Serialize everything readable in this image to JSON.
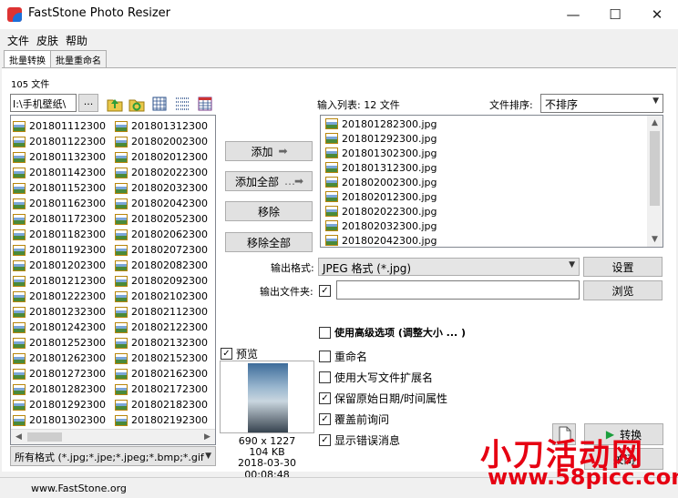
{
  "window": {
    "title": "FastStone Photo Resizer"
  },
  "menu": [
    "文件",
    "皮肤",
    "帮助"
  ],
  "tabs": [
    "批量转换",
    "批量重命名"
  ],
  "source": {
    "count_label": "105 文件",
    "folder_path": "I:\\手机壁纸\\",
    "browse_label": "...",
    "files_col1": [
      "201801112300",
      "201801122300",
      "201801132300",
      "201801142300",
      "201801152300",
      "201801162300",
      "201801172300",
      "201801182300",
      "201801192300",
      "201801202300",
      "201801212300",
      "201801222300",
      "201801232300",
      "201801242300",
      "201801252300",
      "201801262300",
      "201801272300",
      "201801282300",
      "201801292300",
      "201801302300"
    ],
    "files_col2": [
      "201801312300",
      "201802002300",
      "201802012300",
      "201802022300",
      "201802032300",
      "201802042300",
      "201802052300",
      "201802062300",
      "201802072300",
      "201802082300",
      "201802092300",
      "201802102300",
      "201802112300",
      "201802122300",
      "201802132300",
      "201802152300",
      "201802162300",
      "201802172300",
      "201802182300",
      "201802192300"
    ],
    "filter": "所有格式 (*.jpg;*.jpe;*.jpeg;*.bmp;*.gif"
  },
  "actions": {
    "add": "添加",
    "add_all": "添加全部",
    "remove": "移除",
    "remove_all": "移除全部"
  },
  "input_list": {
    "label": "输入列表: 12 文件",
    "sort_label": "文件排序:",
    "sort_value": "不排序",
    "files": [
      "201801282300.jpg",
      "201801292300.jpg",
      "201801302300.jpg",
      "201801312300.jpg",
      "201802002300.jpg",
      "201802012300.jpg",
      "201802022300.jpg",
      "201802032300.jpg",
      "201802042300.jpg"
    ]
  },
  "output": {
    "format_label": "输出格式:",
    "format_value": "JPEG 格式 (*.jpg)",
    "settings_button": "设置",
    "folder_label": "输出文件夹:",
    "folder_value": "",
    "browse_button": "浏览"
  },
  "options": {
    "advanced": {
      "label": "使用高级选项 (调整大小 ... )",
      "checked": false
    },
    "rename": {
      "label": "重命名",
      "checked": false
    },
    "uppercase_ext": {
      "label": "使用大写文件扩展名",
      "checked": false
    },
    "keep_date": {
      "label": "保留原始日期/时间属性",
      "checked": true
    },
    "overwrite_prompt": {
      "label": "覆盖前询问",
      "checked": true
    },
    "show_errors": {
      "label": "显示错误消息",
      "checked": true
    }
  },
  "preview": {
    "label": "预览",
    "checked": true,
    "dimensions": "690 x 1227",
    "size": "104 KB",
    "date": "2018-03-30 00:08:48"
  },
  "convert_button": "转换",
  "close_button": "关闭",
  "status": {
    "url": "www.FastStone.org"
  },
  "watermark": {
    "text": "小刀活动网",
    "url": "www.58picc.com"
  },
  "colors": {
    "accent_green": "#1a9e3c",
    "watermark_red": "#e60012"
  }
}
